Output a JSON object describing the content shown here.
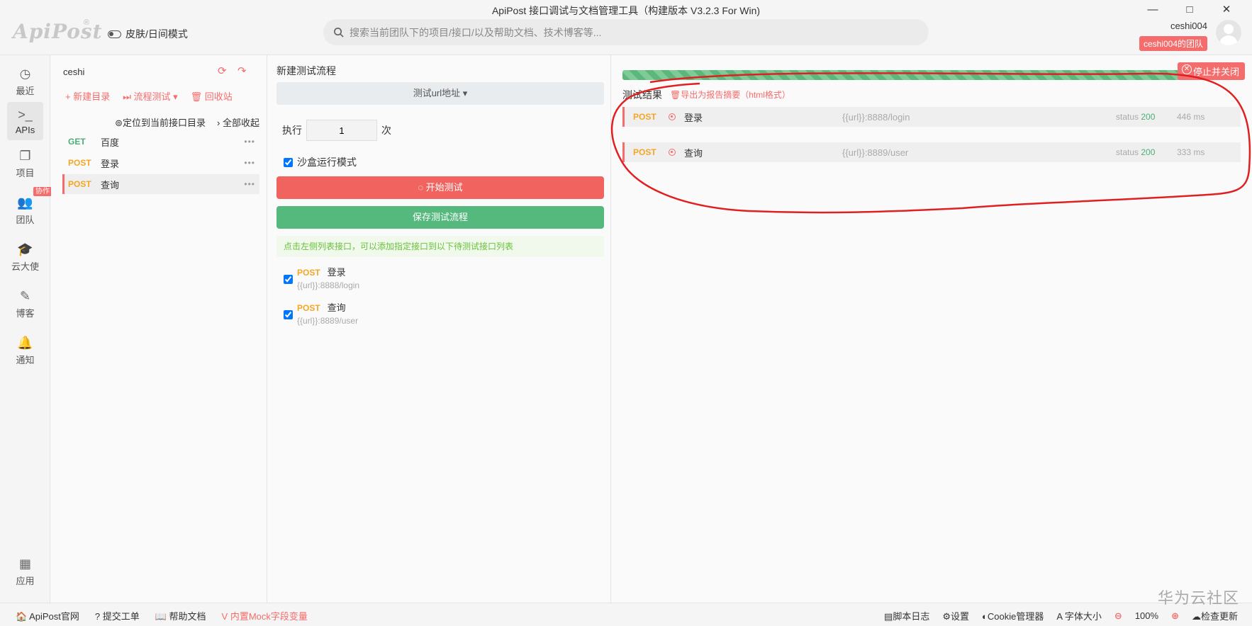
{
  "window": {
    "title": "ApiPost 接口调试与文档管理工具（构建版本 V3.2.3 For Win)",
    "controls": [
      "—",
      "□",
      "✕"
    ]
  },
  "header": {
    "logo": "ApiPost",
    "logo_mark": "®",
    "skin_label": "皮肤/日间模式",
    "search_placeholder": "搜索当前团队下的项目/接口/以及帮助文档、技术博客等...",
    "user": "ceshi004",
    "team": "ceshi004的团队"
  },
  "nav": [
    {
      "label": "最近",
      "icon": "◷"
    },
    {
      "label": "APIs",
      "icon": ">_"
    },
    {
      "label": "项目",
      "icon": "❐"
    },
    {
      "label": "团队",
      "icon": "👥",
      "tag": "协作"
    },
    {
      "label": "云大使",
      "icon": "🎓"
    },
    {
      "label": "博客",
      "icon": "✎"
    },
    {
      "label": "通知",
      "icon": "🔔"
    },
    {
      "label": "应用",
      "icon": "▦"
    }
  ],
  "tree": {
    "project": "ceshi",
    "actions": [
      "+ 新建目录",
      "⏭ 流程测试 ▾",
      "🗑 回收站"
    ],
    "tools": [
      "⊚定位到当前接口目录",
      "› 全部收起"
    ],
    "apis": [
      {
        "method": "GET",
        "name": "百度"
      },
      {
        "method": "POST",
        "name": "登录"
      },
      {
        "method": "POST",
        "name": "查询"
      }
    ]
  },
  "flow": {
    "title": "新建测试流程",
    "url_select": "测试url地址 ▾",
    "exec_label": "执行",
    "exec_value": "1",
    "exec_unit": "次",
    "sandbox": "沙盒运行模式",
    "start": "开始测试",
    "save": "保存测试流程",
    "hint": "点击左侧列表接口，可以添加指定接口到以下待测试接口列表",
    "items": [
      {
        "method": "POST",
        "name": "登录",
        "url": "{{url}}:8888/login"
      },
      {
        "method": "POST",
        "name": "查询",
        "url": "{{url}}:8889/user"
      }
    ]
  },
  "results": {
    "stop": "停止并关闭",
    "title": "测试结果",
    "export": "导出为报告摘要（html格式）",
    "rows": [
      {
        "method": "POST",
        "name": "登录",
        "url": "{{url}}:8888/login",
        "status_label": "status",
        "status": "200",
        "time": "446 ms"
      },
      {
        "method": "POST",
        "name": "查询",
        "url": "{{url}}:8889/user",
        "status_label": "status",
        "status": "200",
        "time": "333 ms"
      }
    ]
  },
  "footer": {
    "left": [
      "🏠 ApiPost官网",
      "? 提交工单",
      "📖 帮助文档",
      "V 内置Mock字段变量"
    ],
    "log": "脚本日志",
    "settings": "⚙设置",
    "cookie": "Cookie管理器",
    "font": "A 字体大小",
    "zoom": "100%",
    "update": "检查更新"
  },
  "watermark": "华为云社区",
  "colors": {
    "accent": "#f56c6c",
    "success": "#55b97e",
    "post": "#f5a623",
    "get": "#4cae77",
    "annotation": "#e02020"
  }
}
